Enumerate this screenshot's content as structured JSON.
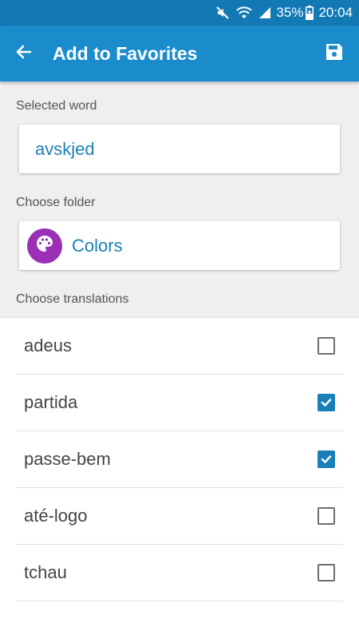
{
  "status_bar": {
    "battery_percent": "35%",
    "time": "20:04",
    "icons": [
      "mute-icon",
      "wifi-icon",
      "signal-icon",
      "battery-icon"
    ]
  },
  "app_bar": {
    "title": "Add to Favorites",
    "back_icon": "arrow-back-icon",
    "save_icon": "save-icon"
  },
  "selected_word": {
    "label": "Selected word",
    "value": "avskjed"
  },
  "folder": {
    "label": "Choose folder",
    "name": "Colors",
    "icon": "palette-icon",
    "icon_bg": "#9b2fb5"
  },
  "translations": {
    "label": "Choose translations",
    "items": [
      {
        "text": "adeus",
        "checked": false
      },
      {
        "text": "partida",
        "checked": true
      },
      {
        "text": "passe-bem",
        "checked": true
      },
      {
        "text": "até-logo",
        "checked": false
      },
      {
        "text": "tchau",
        "checked": false
      }
    ]
  },
  "colors": {
    "status_bar": "#1279b5",
    "app_bar": "#1a8ccc",
    "accent": "#1a7fb8",
    "background_gray": "#efefef"
  }
}
